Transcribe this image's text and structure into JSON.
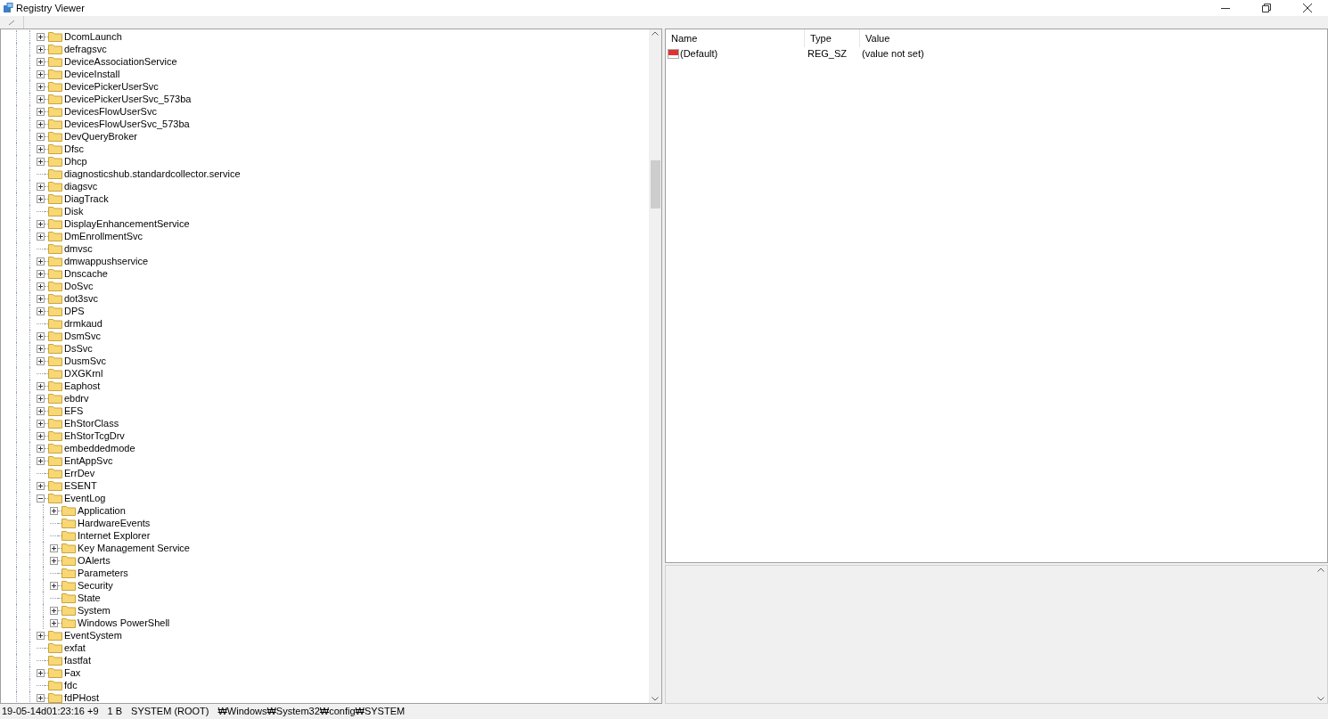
{
  "window": {
    "title": "Registry Viewer"
  },
  "tree": [
    {
      "name": "DcomLaunch",
      "expandable": true,
      "expanded": false
    },
    {
      "name": "defragsvc",
      "expandable": true,
      "expanded": false
    },
    {
      "name": "DeviceAssociationService",
      "expandable": true,
      "expanded": false
    },
    {
      "name": "DeviceInstall",
      "expandable": true,
      "expanded": false
    },
    {
      "name": "DevicePickerUserSvc",
      "expandable": true,
      "expanded": false
    },
    {
      "name": "DevicePickerUserSvc_573ba",
      "expandable": true,
      "expanded": false
    },
    {
      "name": "DevicesFlowUserSvc",
      "expandable": true,
      "expanded": false
    },
    {
      "name": "DevicesFlowUserSvc_573ba",
      "expandable": true,
      "expanded": false
    },
    {
      "name": "DevQueryBroker",
      "expandable": true,
      "expanded": false
    },
    {
      "name": "Dfsc",
      "expandable": true,
      "expanded": false
    },
    {
      "name": "Dhcp",
      "expandable": true,
      "expanded": false
    },
    {
      "name": "diagnosticshub.standardcollector.service",
      "expandable": false
    },
    {
      "name": "diagsvc",
      "expandable": true,
      "expanded": false
    },
    {
      "name": "DiagTrack",
      "expandable": true,
      "expanded": false
    },
    {
      "name": "Disk",
      "expandable": false
    },
    {
      "name": "DisplayEnhancementService",
      "expandable": true,
      "expanded": false
    },
    {
      "name": "DmEnrollmentSvc",
      "expandable": true,
      "expanded": false
    },
    {
      "name": "dmvsc",
      "expandable": false
    },
    {
      "name": "dmwappushservice",
      "expandable": true,
      "expanded": false
    },
    {
      "name": "Dnscache",
      "expandable": true,
      "expanded": false
    },
    {
      "name": "DoSvc",
      "expandable": true,
      "expanded": false
    },
    {
      "name": "dot3svc",
      "expandable": true,
      "expanded": false
    },
    {
      "name": "DPS",
      "expandable": true,
      "expanded": false
    },
    {
      "name": "drmkaud",
      "expandable": false
    },
    {
      "name": "DsmSvc",
      "expandable": true,
      "expanded": false
    },
    {
      "name": "DsSvc",
      "expandable": true,
      "expanded": false
    },
    {
      "name": "DusmSvc",
      "expandable": true,
      "expanded": false
    },
    {
      "name": "DXGKrnl",
      "expandable": false
    },
    {
      "name": "Eaphost",
      "expandable": true,
      "expanded": false
    },
    {
      "name": "ebdrv",
      "expandable": true,
      "expanded": false
    },
    {
      "name": "EFS",
      "expandable": true,
      "expanded": false
    },
    {
      "name": "EhStorClass",
      "expandable": true,
      "expanded": false
    },
    {
      "name": "EhStorTcgDrv",
      "expandable": true,
      "expanded": false
    },
    {
      "name": "embeddedmode",
      "expandable": true,
      "expanded": false
    },
    {
      "name": "EntAppSvc",
      "expandable": true,
      "expanded": false
    },
    {
      "name": "ErrDev",
      "expandable": false
    },
    {
      "name": "ESENT",
      "expandable": true,
      "expanded": false
    },
    {
      "name": "EventLog",
      "expandable": true,
      "expanded": true,
      "children": [
        {
          "name": "Application",
          "expandable": true,
          "expanded": false
        },
        {
          "name": "HardwareEvents",
          "expandable": false
        },
        {
          "name": "Internet Explorer",
          "expandable": false
        },
        {
          "name": "Key Management Service",
          "expandable": true,
          "expanded": false
        },
        {
          "name": "OAlerts",
          "expandable": true,
          "expanded": false
        },
        {
          "name": "Parameters",
          "expandable": false
        },
        {
          "name": "Security",
          "expandable": true,
          "expanded": false
        },
        {
          "name": "State",
          "expandable": false
        },
        {
          "name": "System",
          "expandable": true,
          "expanded": false
        },
        {
          "name": "Windows PowerShell",
          "expandable": true,
          "expanded": false
        }
      ]
    },
    {
      "name": "EventSystem",
      "expandable": true,
      "expanded": false
    },
    {
      "name": "exfat",
      "expandable": false
    },
    {
      "name": "fastfat",
      "expandable": false
    },
    {
      "name": "Fax",
      "expandable": true,
      "expanded": false
    },
    {
      "name": "fdc",
      "expandable": false
    },
    {
      "name": "fdPHost",
      "expandable": true,
      "expanded": false
    }
  ],
  "values": {
    "columns": [
      "Name",
      "Type",
      "Value"
    ],
    "rows": [
      {
        "name": "(Default)",
        "type": "REG_SZ",
        "value": "(value not set)"
      }
    ]
  },
  "status_bar": [
    "19-05-14d01:23:16 +9",
    "1 B",
    "SYSTEM (ROOT)",
    "₩Windows₩System32₩config₩SYSTEM"
  ]
}
